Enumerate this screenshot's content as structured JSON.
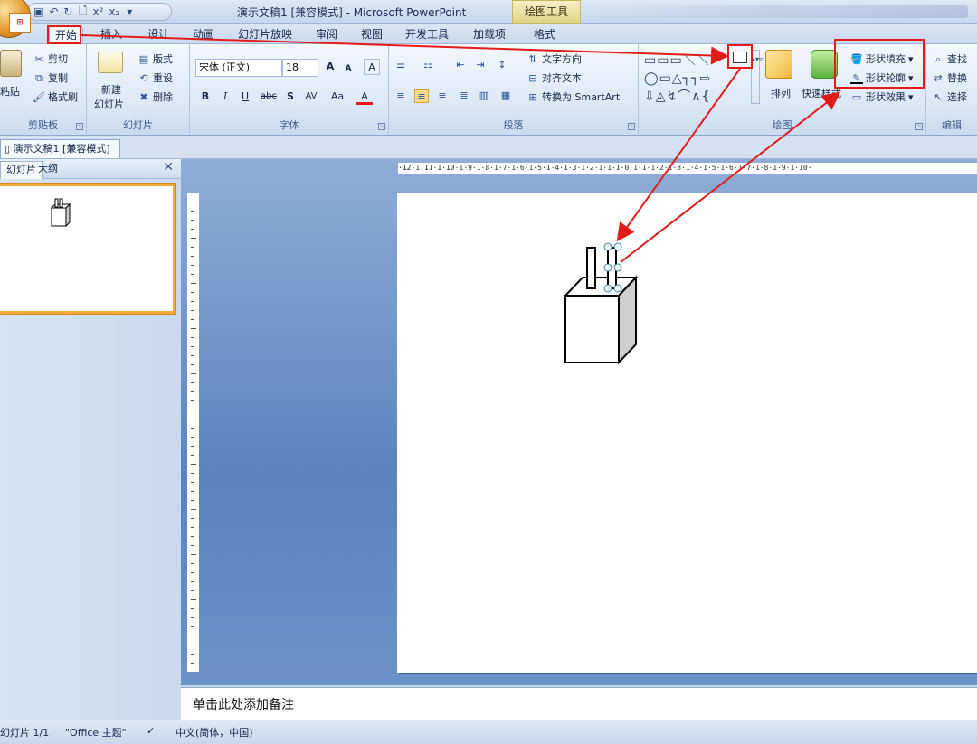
{
  "window": {
    "title": "演示文稿1 [兼容模式] - Microsoft PowerPoint",
    "contextual_tab": "绘图工具"
  },
  "qat": {
    "save": "▣",
    "undo": "↶",
    "redo": "↻",
    "preview": "🗋",
    "sup": "x²",
    "sub": "x₂",
    "more": "▾"
  },
  "tabs": [
    "开始",
    "插入",
    "设计",
    "动画",
    "幻灯片放映",
    "审阅",
    "视图",
    "开发工具",
    "加载项",
    "格式"
  ],
  "ribbon": {
    "clipboard": {
      "label": "剪贴板",
      "paste": "粘贴",
      "cut": "剪切",
      "copy": "复制",
      "format_painter": "格式刷"
    },
    "slides": {
      "label": "幻灯片",
      "new_slide": "新建",
      "new_slide2": "幻灯片",
      "layout": "版式",
      "reset": "重设",
      "delete": "删除"
    },
    "font": {
      "label": "字体",
      "font_name": "宋体 (正文)",
      "font_size": "18",
      "grow": "A",
      "shrink": "A",
      "clear": "A",
      "bold": "B",
      "italic": "I",
      "underline": "U",
      "strike": "abc",
      "shadow": "S",
      "spacing": "AV",
      "case": "Aa",
      "color": "A"
    },
    "paragraph": {
      "label": "段落",
      "text_direction": "文字方向",
      "align_text": "对齐文本",
      "smartart": "转换为 SmartArt"
    },
    "drawing": {
      "label": "绘图",
      "arrange": "排列",
      "quick_styles": "快速样式",
      "shape_fill": "形状填充",
      "shape_outline": "形状轮廓",
      "shape_effects": "形状效果"
    },
    "editing": {
      "label": "编辑",
      "find": "查找",
      "replace": "替换",
      "select": "选择"
    }
  },
  "doc_tab": "演示文稿1 [兼容模式]",
  "left_pane": {
    "tab_slides": "幻灯片",
    "tab_outline": "大纲",
    "close": "✕"
  },
  "ruler": {
    "h_ticks": "·12·1·11·1·10·1·9·1·8·1·7·1·6·1·5·1·4·1·3·1·2·1·1·1·0·1·1·1·2·1·3·1·4·1·5·1·6·1·7·1·8·1·9·1·10·"
  },
  "notes": {
    "placeholder": "单击此处添加备注"
  },
  "status": {
    "slide": "幻灯片 1/1",
    "theme": "\"Office 主题\"",
    "language": "中文(简体，中国)"
  },
  "colors": {
    "annotation": "#e31b1b",
    "accent": "#f0a83c"
  }
}
